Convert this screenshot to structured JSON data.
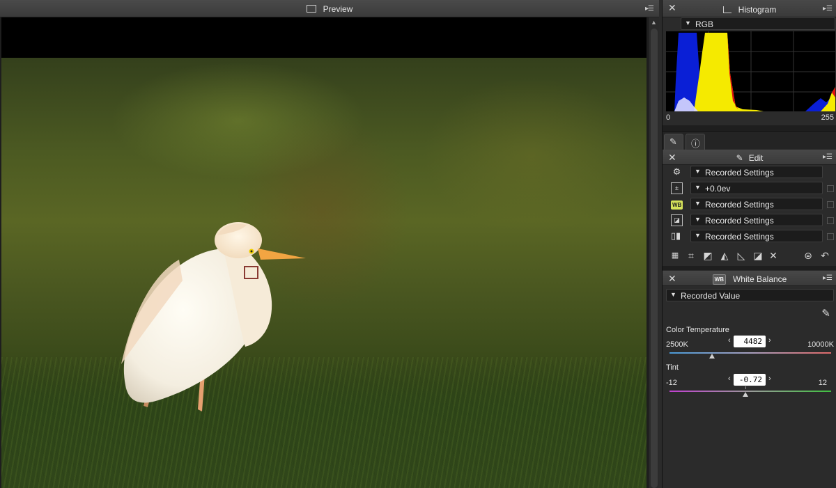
{
  "preview": {
    "title": "Preview"
  },
  "histogram": {
    "title": "Histogram",
    "channel": "RGB",
    "min_label": "0",
    "max_label": "255"
  },
  "edit": {
    "title": "Edit",
    "rows": [
      {
        "icon": "gear-icon",
        "value": "Recorded Settings"
      },
      {
        "icon": "exposure-icon",
        "value": "+0.0ev"
      },
      {
        "icon": "wb-icon",
        "badge": "WB",
        "value": "Recorded Settings"
      },
      {
        "icon": "picture-control-icon",
        "value": "Recorded Settings"
      },
      {
        "icon": "active-d-lighting-icon",
        "value": "Recorded Settings"
      }
    ],
    "tools": [
      "noise-reduction-icon",
      "crop-icon",
      "levels-curves-icon",
      "lch-icon",
      "perspective-icon",
      "tone-icon",
      "retouch-brush-icon",
      "history-icon",
      "undo-icon"
    ]
  },
  "white_balance": {
    "title": "White Balance",
    "badge": "WB",
    "mode": "Recorded Value",
    "color_temperature": {
      "label": "Color Temperature",
      "value": "4482",
      "min_label": "2500K",
      "max_label": "10000K",
      "min": 2500,
      "max": 10000
    },
    "tint": {
      "label": "Tint",
      "value": "-0.72",
      "min_label": "-12",
      "max_label": "12",
      "min": -12,
      "max": 12
    }
  },
  "colors": {
    "panel_bg": "#2b2b2b",
    "header_bg": "#3f3f3f",
    "histogram_blue": "#0a1fd6",
    "histogram_yellow": "#f5ea00",
    "histogram_red": "#e01010",
    "wb_badge": "#d6e25a"
  }
}
